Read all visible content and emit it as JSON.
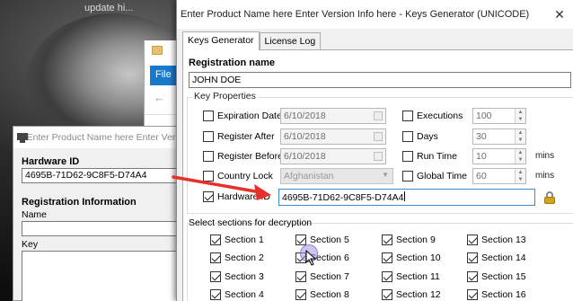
{
  "background": {
    "text": "update hi..."
  },
  "explorer": {
    "file_tab": "File"
  },
  "left_window": {
    "title": "Enter Product Name here Enter Versi",
    "hardware_id_label": "Hardware ID",
    "hardware_id_value": "4695B-71D62-9C8F5-D74A4",
    "registration_info_label": "Registration Information",
    "name_label": "Name",
    "key_label": "Key"
  },
  "main_window": {
    "title": "Enter Product Name here Enter Version Info here - Keys Generator (UNICODE)",
    "close_label": "✕",
    "tabs": [
      {
        "label": "Keys Generator",
        "active": true
      },
      {
        "label": "License Log",
        "active": false
      }
    ],
    "registration_name_label": "Registration name",
    "registration_name_value": "JOHN DOE",
    "key_properties_label": "Key Properties",
    "properties": {
      "expiration_date": {
        "label": "Expiration Date",
        "checked": false,
        "value": "6/10/2018"
      },
      "register_after": {
        "label": "Register After",
        "checked": false,
        "value": "6/10/2018"
      },
      "register_before": {
        "label": "Register Before",
        "checked": false,
        "value": "6/10/2018"
      },
      "country_lock": {
        "label": "Country Lock",
        "checked": false,
        "value": "Afghanistan"
      },
      "hardware_id": {
        "label": "Hardware ID",
        "checked": true,
        "value": "4695B-71D62-9C8F5-D74A4"
      },
      "executions": {
        "label": "Executions",
        "checked": false,
        "value": "100"
      },
      "days": {
        "label": "Days",
        "checked": false,
        "value": "30"
      },
      "run_time": {
        "label": "Run Time",
        "checked": false,
        "value": "10",
        "unit": "mins"
      },
      "global_time": {
        "label": "Global Time",
        "checked": false,
        "value": "60",
        "unit": "mins"
      }
    },
    "sections_label": "Select sections for decryption",
    "sections": [
      {
        "label": "Section 1",
        "checked": true
      },
      {
        "label": "Section 2",
        "checked": true
      },
      {
        "label": "Section 3",
        "checked": true
      },
      {
        "label": "Section 4",
        "checked": true
      },
      {
        "label": "Section 5",
        "checked": true
      },
      {
        "label": "Section 6",
        "checked": true
      },
      {
        "label": "Section 7",
        "checked": true
      },
      {
        "label": "Section 8",
        "checked": true
      },
      {
        "label": "Section 9",
        "checked": true
      },
      {
        "label": "Section 10",
        "checked": true
      },
      {
        "label": "Section 11",
        "checked": true
      },
      {
        "label": "Section 12",
        "checked": true
      },
      {
        "label": "Section 13",
        "checked": true
      },
      {
        "label": "Section 14",
        "checked": true
      },
      {
        "label": "Section 15",
        "checked": true
      },
      {
        "label": "Section 16",
        "checked": true
      }
    ],
    "annotation_color": "#e8302a"
  }
}
